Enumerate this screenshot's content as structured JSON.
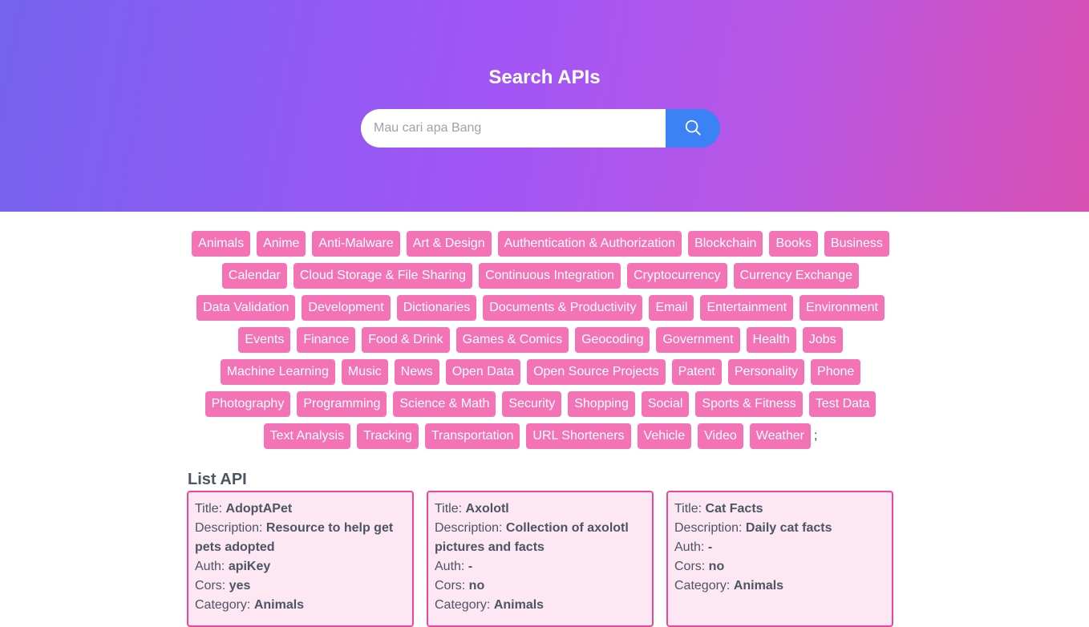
{
  "header": {
    "title": "Search APIs",
    "search_placeholder": "Mau cari apa Bang",
    "search_value": ""
  },
  "icons": {
    "search_button": "search-icon"
  },
  "colors": {
    "gradient_start": "#7563ee",
    "gradient_mid": "#a155f5",
    "gradient_end": "#d84fb2",
    "search_button": "#3b82f6",
    "category_chip": "#f472b6",
    "card_border": "#ec4899",
    "card_background": "#fce7f3"
  },
  "categories": [
    "Animals",
    "Anime",
    "Anti-Malware",
    "Art & Design",
    "Authentication & Authorization",
    "Blockchain",
    "Books",
    "Business",
    "Calendar",
    "Cloud Storage & File Sharing",
    "Continuous Integration",
    "Cryptocurrency",
    "Currency Exchange",
    "Data Validation",
    "Development",
    "Dictionaries",
    "Documents & Productivity",
    "Email",
    "Entertainment",
    "Environment",
    "Events",
    "Finance",
    "Food & Drink",
    "Games & Comics",
    "Geocoding",
    "Government",
    "Health",
    "Jobs",
    "Machine Learning",
    "Music",
    "News",
    "Open Data",
    "Open Source Projects",
    "Patent",
    "Personality",
    "Phone",
    "Photography",
    "Programming",
    "Science & Math",
    "Security",
    "Shopping",
    "Social",
    "Sports & Fitness",
    "Test Data",
    "Text Analysis",
    "Tracking",
    "Transportation",
    "URL Shorteners",
    "Vehicle",
    "Video",
    "Weather"
  ],
  "categories_trailing_text": ";",
  "list": {
    "title": "List API",
    "field_labels": {
      "title": "Title: ",
      "description": "Description: ",
      "auth": "Auth: ",
      "cors": "Cors: ",
      "category": "Category: "
    },
    "items": [
      {
        "title": "AdoptAPet",
        "description": "Resource to help get pets adopted",
        "auth": "apiKey",
        "cors": "yes",
        "category": "Animals"
      },
      {
        "title": "Axolotl",
        "description": "Collection of axolotl pictures and facts",
        "auth": "-",
        "cors": "no",
        "category": "Animals"
      },
      {
        "title": "Cat Facts",
        "description": "Daily cat facts",
        "auth": "-",
        "cors": "no",
        "category": "Animals"
      }
    ]
  }
}
